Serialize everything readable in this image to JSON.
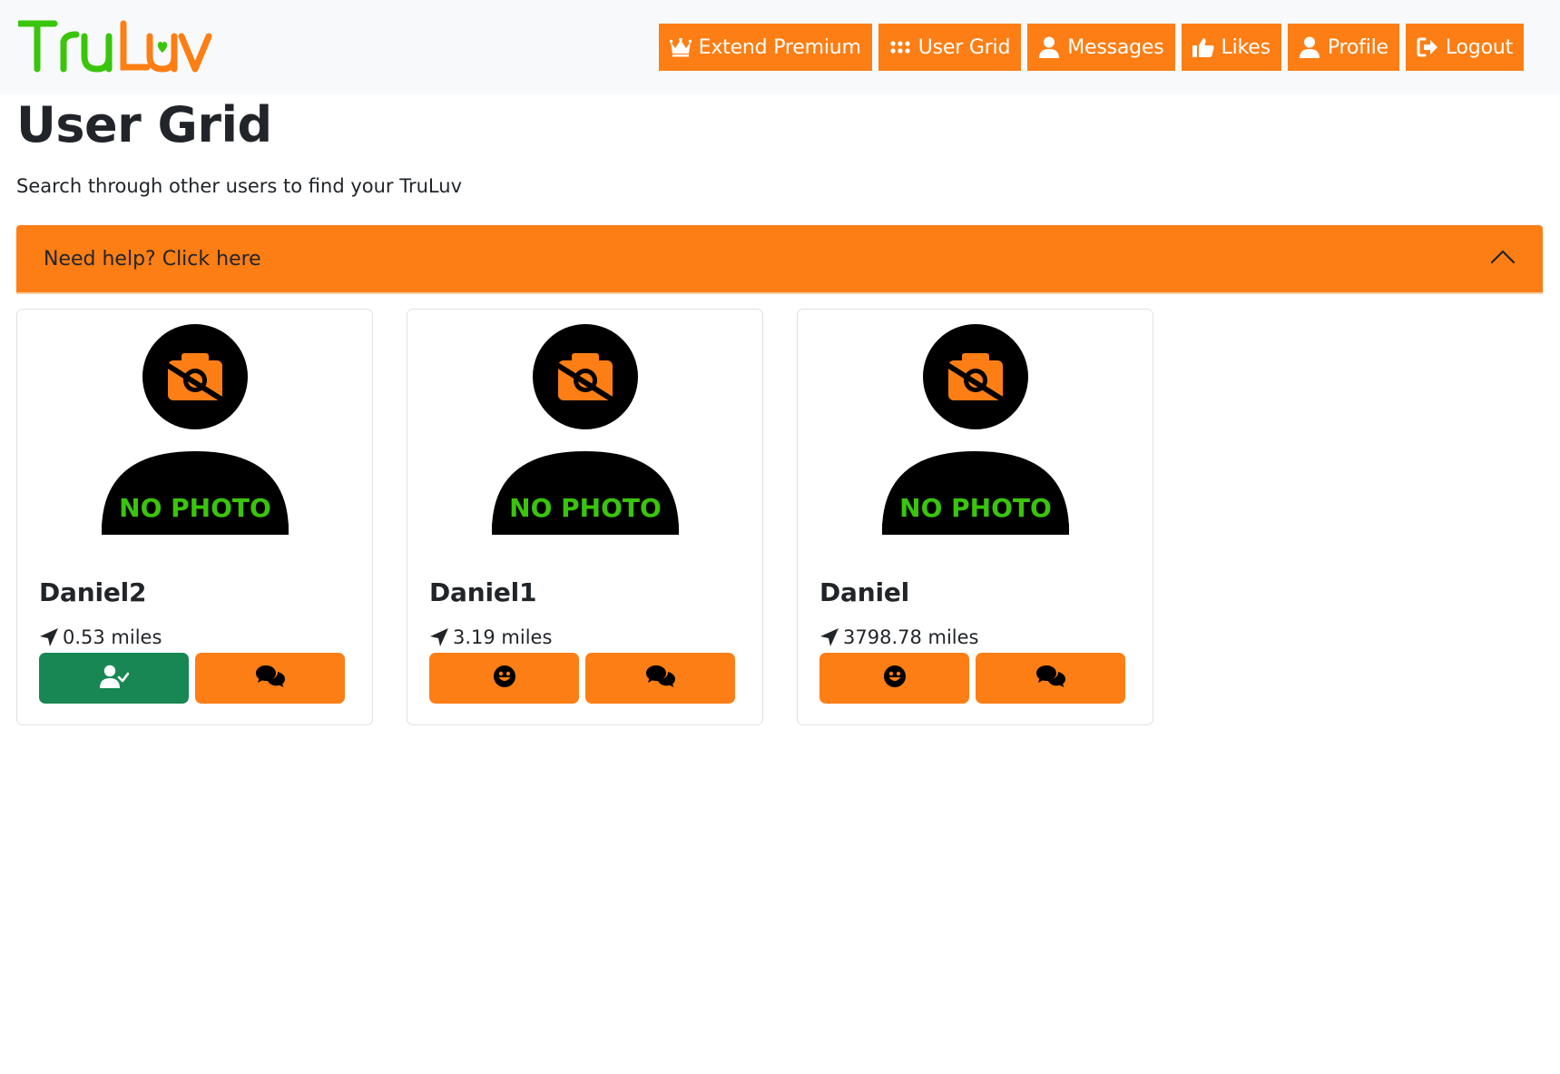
{
  "brand": {
    "logo_text": "TruLuv"
  },
  "nav": {
    "items": [
      {
        "label": "Extend Premium",
        "icon": "crown-icon"
      },
      {
        "label": "User Grid",
        "icon": "grid-icon"
      },
      {
        "label": "Messages",
        "icon": "user-icon"
      },
      {
        "label": "Likes",
        "icon": "thumbs-up-icon"
      },
      {
        "label": "Profile",
        "icon": "user-icon"
      },
      {
        "label": "Logout",
        "icon": "logout-icon"
      }
    ]
  },
  "page": {
    "title": "User Grid",
    "subtitle": "Search through other users to find your TruLuv"
  },
  "help": {
    "label": "Need help? Click here",
    "icon": "chevron-up-icon"
  },
  "users": [
    {
      "name": "Daniel2",
      "distance": "0.53 miles",
      "photo_text": "NO PHOTO",
      "like_state": "matched",
      "like_icon": "user-check-icon",
      "message_icon": "chat-icon"
    },
    {
      "name": "Daniel1",
      "distance": "3.19 miles",
      "photo_text": "NO PHOTO",
      "like_state": "not-liked",
      "like_icon": "smile-icon",
      "message_icon": "chat-icon"
    },
    {
      "name": "Daniel",
      "distance": "3798.78 miles",
      "photo_text": "NO PHOTO",
      "like_state": "not-liked",
      "like_icon": "smile-icon",
      "message_icon": "chat-icon"
    }
  ],
  "colors": {
    "accent": "#fd7e14",
    "success": "#198754",
    "logo_green": "#39c50b",
    "navbar_bg": "#f8f9fa",
    "text": "#212529"
  }
}
